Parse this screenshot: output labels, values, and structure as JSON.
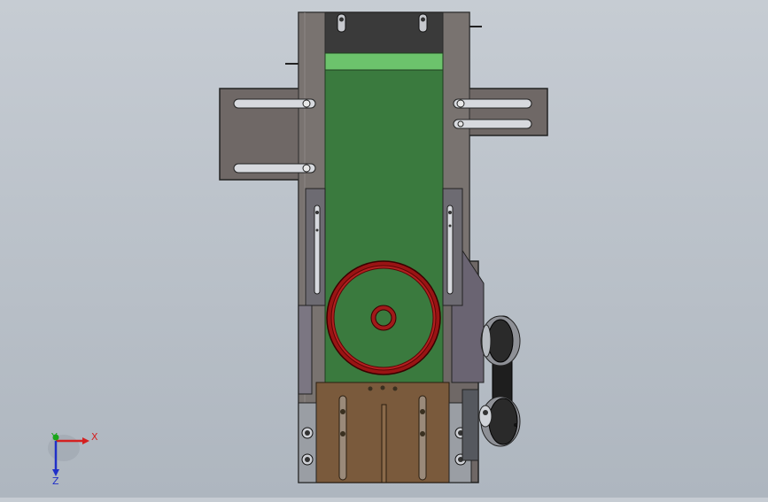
{
  "viewport": {
    "background_top": "#c6ccd3",
    "background_bottom": "#aeb6bf"
  },
  "triad": {
    "x_label": "X",
    "y_label": "Y",
    "z_label": "Z",
    "x_color": "#d42020",
    "y_color": "#1aa51a",
    "z_color": "#2030c8"
  },
  "colors": {
    "frame": "#6f6866",
    "frame_dark": "#4f4a49",
    "belt_green": "#3a7a3e",
    "belt_light": "#6cc36c",
    "roller_red": "#a11a1a",
    "plate_brown": "#7a5a3c",
    "steel": "#8e9096",
    "slot": "#d7d9de"
  }
}
